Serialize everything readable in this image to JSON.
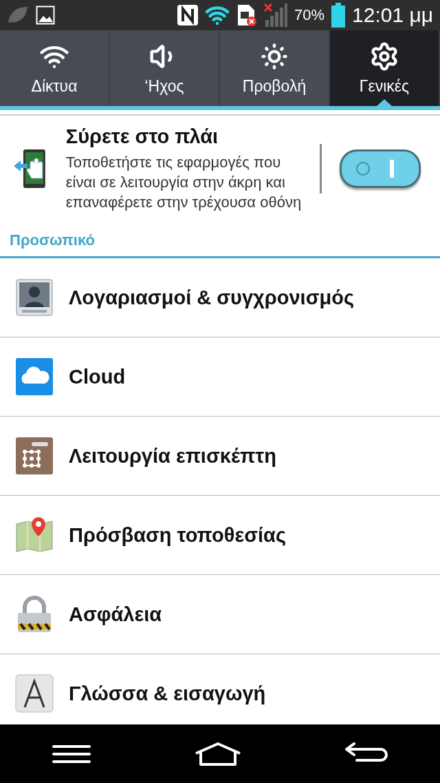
{
  "status_bar": {
    "battery": "70%",
    "time": "12:01 μμ"
  },
  "tabs": [
    {
      "label": "Δίκτυα",
      "kind": "wifi",
      "selected": false
    },
    {
      "label": "‘Ηχος",
      "kind": "sound",
      "selected": false
    },
    {
      "label": "Προβολή",
      "kind": "display",
      "selected": false
    },
    {
      "label": "Γενικές",
      "kind": "general",
      "selected": true
    }
  ],
  "swipe_setting": {
    "title": "Σύρετε στο πλάι",
    "description": "Τοποθετήστε τις εφαρμογές που είναι σε λειτουργία στην άκρη και επαναφέρετε στην τρέχουσα οθόνη",
    "on": true
  },
  "section_header": "Προσωπικό",
  "items": [
    {
      "label": "Λογαριασμοί & συγχρονισμός",
      "kind": "accounts"
    },
    {
      "label": "Cloud",
      "kind": "cloud"
    },
    {
      "label": "Λειτουργία επισκέπτη",
      "kind": "guest"
    },
    {
      "label": "Πρόσβαση τοποθεσίας",
      "kind": "location"
    },
    {
      "label": "Ασφάλεια",
      "kind": "security"
    },
    {
      "label": "Γλώσσα & εισαγωγή",
      "kind": "language"
    }
  ]
}
